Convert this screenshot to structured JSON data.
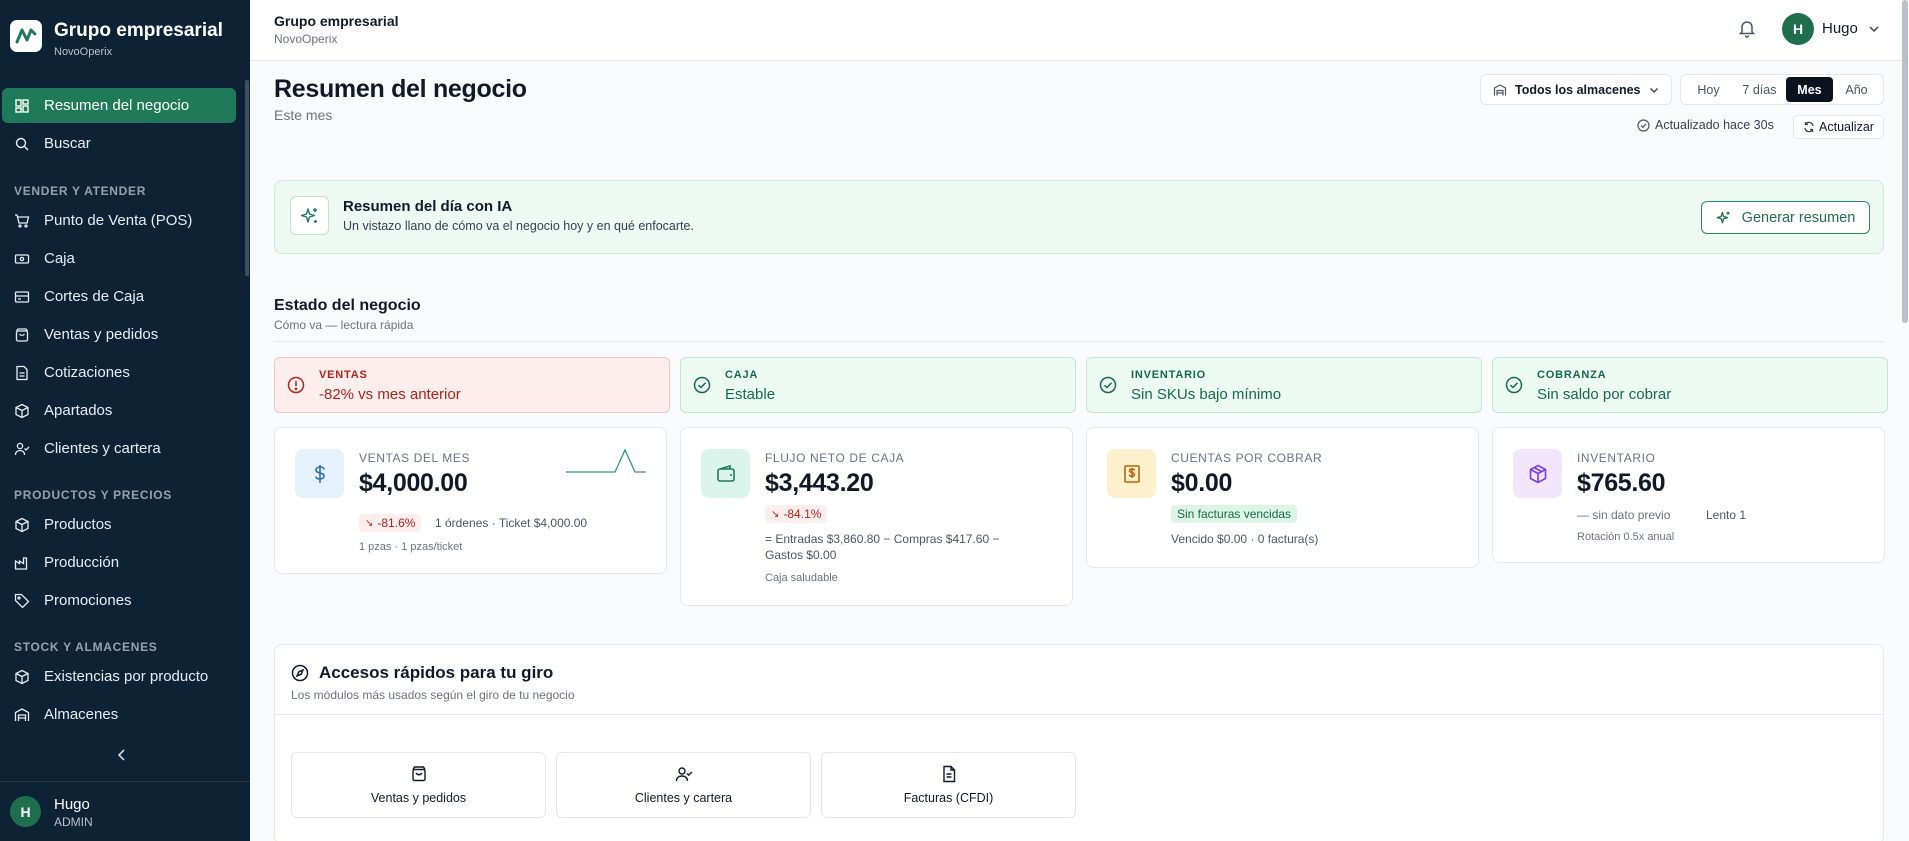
{
  "sidebar": {
    "title": "Grupo empresarial",
    "subtitle": "NovoOperix",
    "items": [
      {
        "label": "Resumen del negocio"
      },
      {
        "label": "Buscar"
      },
      {
        "label": "Punto de Venta (POS)"
      },
      {
        "label": "Caja"
      },
      {
        "label": "Cortes de Caja"
      },
      {
        "label": "Ventas y pedidos"
      },
      {
        "label": "Cotizaciones"
      },
      {
        "label": "Apartados"
      },
      {
        "label": "Clientes y cartera"
      },
      {
        "label": "Productos"
      },
      {
        "label": "Producción"
      },
      {
        "label": "Promociones"
      },
      {
        "label": "Existencias por producto"
      },
      {
        "label": "Almacenes"
      }
    ],
    "sections": [
      "VENDER Y ATENDER",
      "PRODUCTOS Y PRECIOS",
      "STOCK Y ALMACENES"
    ],
    "user": {
      "initial": "H",
      "name": "Hugo",
      "role": "ADMIN"
    }
  },
  "topbar": {
    "title": "Grupo empresarial",
    "subtitle": "NovoOperix",
    "user_initial": "H",
    "user_name": "Hugo"
  },
  "header": {
    "title": "Resumen del negocio",
    "subtitle": "Este mes",
    "warehouse_select": "Todos los almacenes",
    "periods": [
      "Hoy",
      "7 días",
      "Mes",
      "Año"
    ],
    "active_period": "Mes",
    "updated": "Actualizado hace 30s",
    "refresh_label": "Actualizar"
  },
  "ai": {
    "title": "Resumen del día con IA",
    "desc": "Un vistazo llano de cómo va el negocio hoy y en qué enfocarte.",
    "button": "Generar resumen"
  },
  "estado": {
    "title": "Estado del negocio",
    "sub": "Cómo va — lectura rápida",
    "statuses": [
      {
        "label": "VENTAS",
        "value": "-82% vs mes anterior",
        "tone": "red"
      },
      {
        "label": "CAJA",
        "value": "Estable",
        "tone": "green"
      },
      {
        "label": "INVENTARIO",
        "value": "Sin SKUs bajo mínimo",
        "tone": "green"
      },
      {
        "label": "COBRANZA",
        "value": "Sin saldo por cobrar",
        "tone": "green"
      }
    ]
  },
  "kpis": {
    "ventas": {
      "label": "VENTAS DEL MES",
      "value": "$4,000.00",
      "change": "-81.6%",
      "meta": "1 órdenes · Ticket $4,000.00",
      "small": "1 pzas · 1 pzas/ticket"
    },
    "flujo": {
      "label": "FLUJO NETO DE CAJA",
      "value": "$3,443.20",
      "change": "-84.1%",
      "meta1": "= Entradas $3,860.80 − Compras $417.60 −",
      "meta2": "Gastos $0.00",
      "small": "Caja saludable"
    },
    "cxc": {
      "label": "CUENTAS POR COBRAR",
      "value": "$0.00",
      "chip": "Sin facturas vencidas",
      "meta": "Vencido $0.00 · 0 factura(s)"
    },
    "inventario": {
      "label": "INVENTARIO",
      "value": "$765.60",
      "meta": "— sin dato previo",
      "meta2": "Lento 1",
      "small": "Rotación 0.5x anual"
    }
  },
  "accesos": {
    "title": "Accesos rápidos para tu giro",
    "sub": "Los módulos más usados según el giro de tu negocio",
    "tiles": [
      {
        "label": "Ventas y pedidos",
        "icon": "shopping-bag-icon"
      },
      {
        "label": "Clientes y cartera",
        "icon": "user-check-icon"
      },
      {
        "label": "Facturas (CFDI)",
        "icon": "document-icon"
      }
    ]
  },
  "colors": {
    "sidebar_bg": "#0e2235",
    "accent": "#1f7a5a",
    "danger": "#b42318",
    "success": "#166b47"
  }
}
